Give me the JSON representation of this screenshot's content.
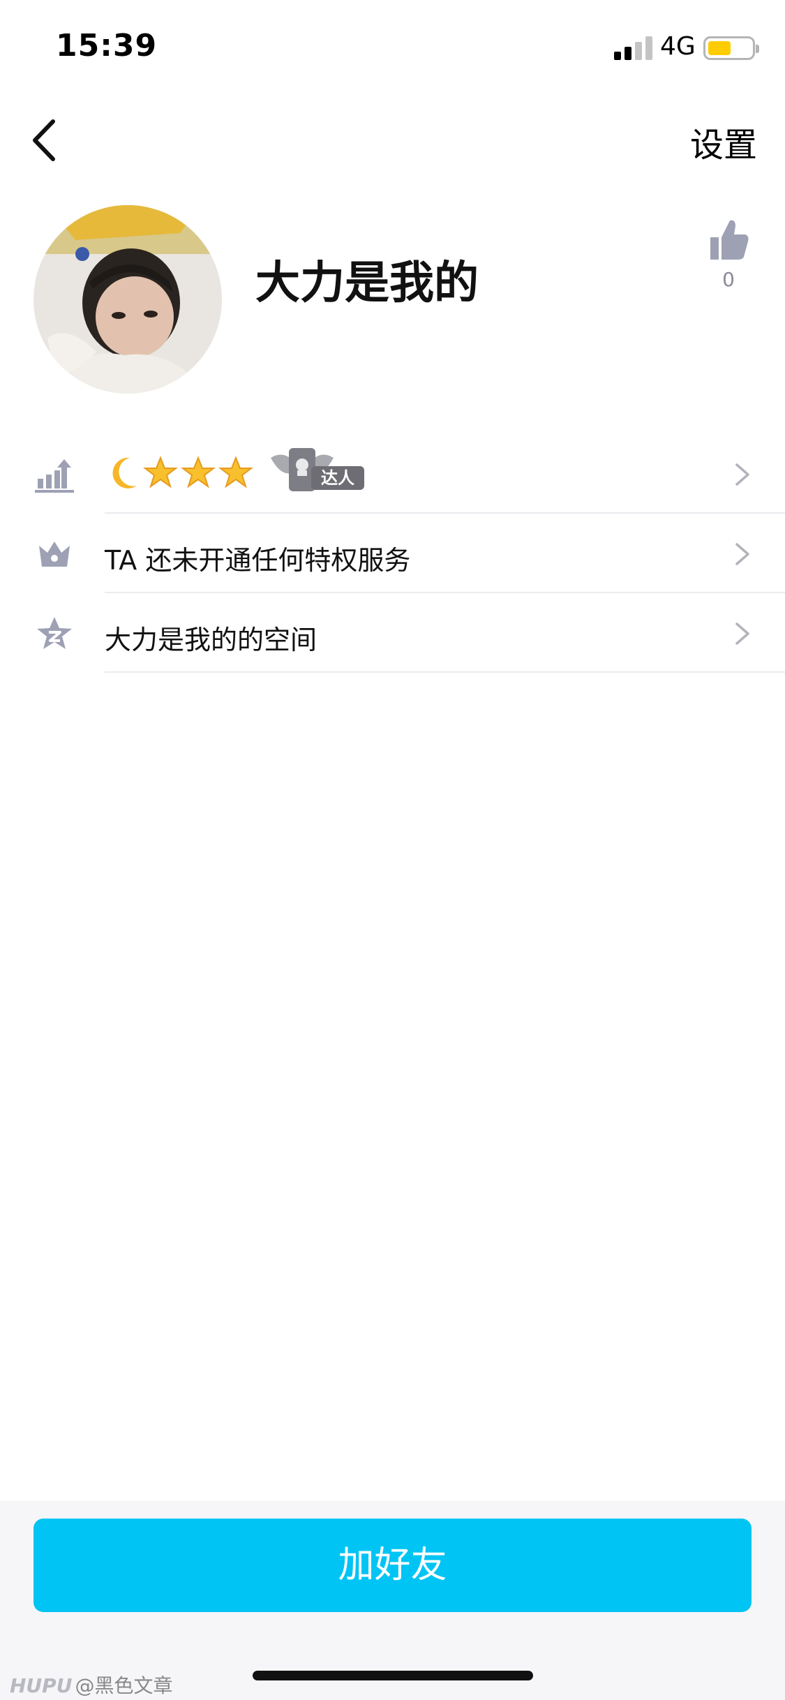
{
  "status_bar": {
    "time": "15:39",
    "network": "4G",
    "signal_bars": 2,
    "battery_color": "#ffcc00"
  },
  "nav": {
    "back_icon": "chevron-left-icon",
    "settings_label": "设置"
  },
  "profile": {
    "nickname": "大力是我的",
    "like_count": "0"
  },
  "rows": [
    {
      "icon": "level-up-icon",
      "stars": 3,
      "badge_label": "达人"
    },
    {
      "icon": "crown-icon",
      "label": "TA 还未开通任何特权服务"
    },
    {
      "icon": "qzone-star-icon",
      "label": "大力是我的的空间"
    }
  ],
  "footer": {
    "add_friend_label": "加好友",
    "accent_color": "#00c4f4",
    "watermark_brand": "HUPU",
    "watermark_text": "@黑色文章"
  }
}
